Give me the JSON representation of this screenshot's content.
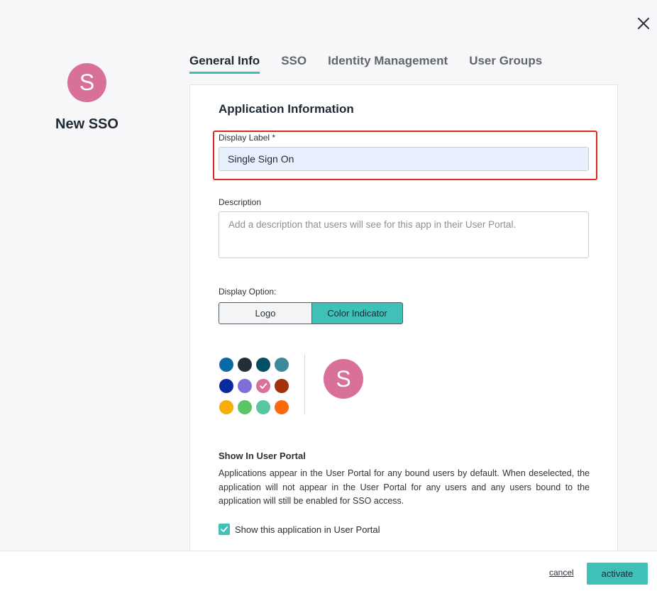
{
  "app": {
    "name": "New SSO",
    "avatar_letter": "S",
    "avatar_color": "#d8709a"
  },
  "tabs": [
    {
      "label": "General Info",
      "active": true
    },
    {
      "label": "SSO",
      "active": false
    },
    {
      "label": "Identity Management",
      "active": false
    },
    {
      "label": "User Groups",
      "active": false
    }
  ],
  "form": {
    "section_title": "Application Information",
    "display_label": {
      "label": "Display Label *",
      "value": "Single Sign On"
    },
    "description": {
      "label": "Description",
      "value": "",
      "placeholder": "Add a description that users will see for this app in their User Portal."
    },
    "display_option": {
      "label": "Display Option:",
      "options": [
        "Logo",
        "Color Indicator"
      ],
      "selected": "Color Indicator"
    },
    "colors": {
      "swatches": [
        "#0a6aa8",
        "#252d3b",
        "#044e66",
        "#3d8a9a",
        "#0b2a9f",
        "#7f6fd9",
        "#d8709a",
        "#a3320c",
        "#f7ad0a",
        "#5ac567",
        "#59c6a3",
        "#fb6a0c"
      ],
      "selected_index": 6,
      "check_icon": "check-icon"
    },
    "show_in_portal": {
      "title": "Show In User Portal",
      "description": "Applications appear in the User Portal for any bound users by default. When deselected, the application will not appear in the User Portal for any users and any users bound to the application will still be enabled for SSO access.",
      "checkbox_label": "Show this application in User Portal",
      "checked": true
    }
  },
  "footer": {
    "cancel_label": "cancel",
    "activate_label": "activate"
  },
  "theme": {
    "accent": "#3fc1b7",
    "highlight_border": "#e0261e"
  }
}
